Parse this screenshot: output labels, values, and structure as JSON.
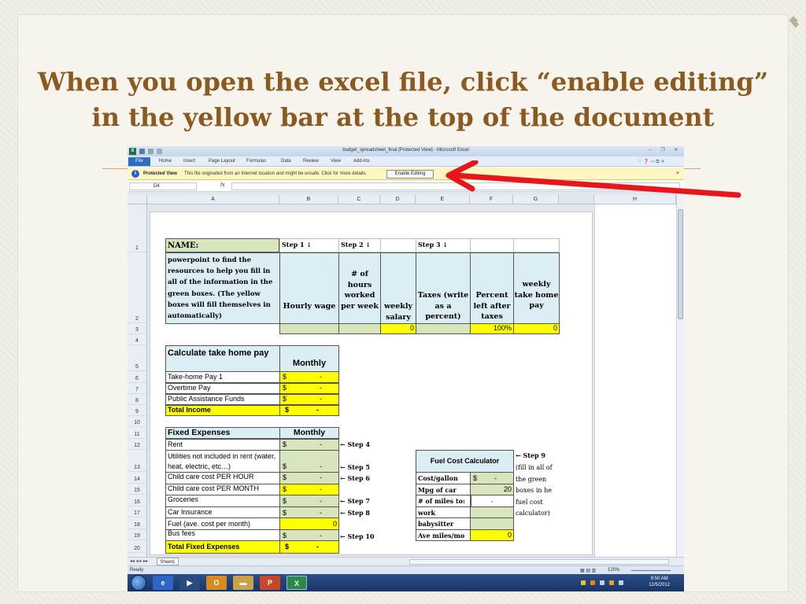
{
  "slide": {
    "title_line1": "When you open the excel file, click “enable editing”",
    "title_line2": "in the yellow bar at the top of the document"
  },
  "excel": {
    "window_title": "budget_spreadsheet_final  [Protected View] - Microsoft Excel",
    "file_tab": "File",
    "ribbon_tabs": [
      "Home",
      "Insert",
      "Page Layout",
      "Formulas",
      "Data",
      "Review",
      "View",
      "Add-Ins"
    ],
    "protected_bar": {
      "label": "Protected View",
      "message": "This file originated from an Internet location and might be unsafe. Click for more details.",
      "button": "Enable Editing",
      "close": "×"
    },
    "name_box": "D4",
    "fx_label": "fx",
    "columns": [
      "A",
      "B",
      "C",
      "D",
      "E",
      "F",
      "G",
      "H"
    ],
    "rows": [
      "1",
      "2",
      "3",
      "4",
      "5",
      "6",
      "7",
      "8",
      "9",
      "10",
      "11",
      "12",
      "13",
      "14",
      "15",
      "16",
      "17",
      "18",
      "19",
      "20"
    ],
    "cells": {
      "a1": "NAME:",
      "b1": "Step 1 ↓",
      "c1": "Step 2 ↓",
      "e1": "Step 3 ↓",
      "a2": "powerpoint to find the resources to help you fill in all of the information in the green boxes. (The yellow boxes will fill themselves in automatically)",
      "b2": "Hourly wage",
      "c2": "# of hours worked per week",
      "d2": "weekly salary",
      "e2": "Taxes (write as a percent)",
      "f2": "Percent left after taxes",
      "g2": "weekly take home pay",
      "d3": "0",
      "f3": "100%",
      "g3": "0",
      "a5": "Calculate take home pay",
      "b5": "Monthly",
      "a6": "Take-home Pay 1",
      "a7": "Overtime Pay",
      "a8": "Public Assistance Funds",
      "a9": "Total Income",
      "a11": "Fixed Expenses",
      "b11": "Monthly",
      "a12": "Rent",
      "a13": "Utilities not included in rent (water, heat, electric, etc…)",
      "a14": "Child care cost PER HOUR",
      "a15": "Child care cost PER MONTH",
      "a16": "Groceries",
      "a17": "Car Insurance",
      "a18": "Fuel (ave. cost per month)",
      "b18": "0",
      "a19": "Bus fees",
      "a20": "Total Fixed Expenses",
      "dollar": "$",
      "dash": "-",
      "step4": "← Step 4",
      "step5": "← Step 5",
      "step6": "← Step 6",
      "step7": "← Step 7",
      "step8": "← Step 8",
      "step10": "← Step 10",
      "fuel_title": "Fuel Cost Calculator",
      "fuel_cost_gallon": "Cost/gallon",
      "fuel_mpg": "Mpg of car",
      "fuel_mpg_val": "20",
      "fuel_miles": "# of miles to:",
      "fuel_work": "work",
      "fuel_babysitter": "babysitter",
      "fuel_ave": "Ave miles/mo",
      "fuel_ave_val": "0",
      "step9": "← Step 9",
      "step9_note": "(fill in all of the green boxes in he fuel cost calculator)"
    },
    "sheet_tab": "Sheet1",
    "status": "Ready",
    "zoom": "125%",
    "clock_time": "9:50 AM",
    "clock_date": "12/5/2012"
  },
  "colors": {
    "title": "#8a5a20",
    "green_cell": "#d8e4bc",
    "blue_cell": "#dbeef4",
    "yellow_cell": "#ffff00",
    "arrow": "#e8161b"
  }
}
